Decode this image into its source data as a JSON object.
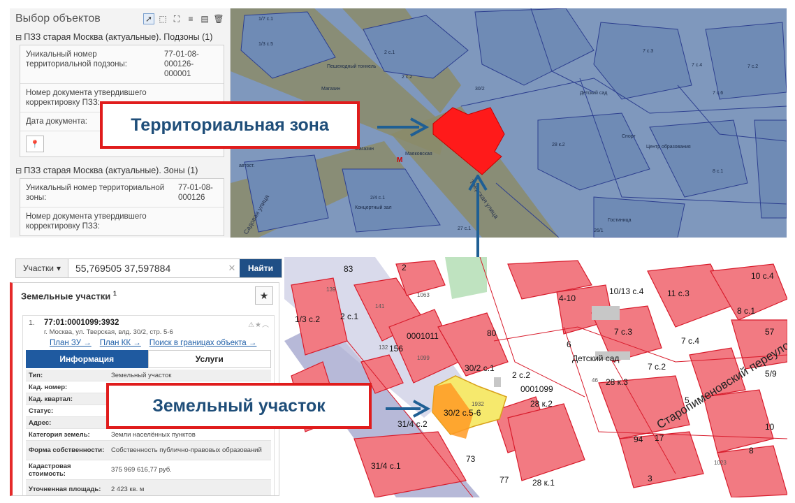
{
  "top_panel": {
    "title": "Выбор объектов",
    "tools": [
      "pointer-icon",
      "frame-select-icon",
      "polygon-select-icon",
      "list-icon",
      "export-icon",
      "trash-icon"
    ],
    "subzones_group": {
      "title": "ПЗЗ старая Москва (актуальные). Подзоны (1)",
      "rows": [
        {
          "key": "Уникальный номер территориальной подзоны:",
          "value": "77-01-08-000126-000001"
        },
        {
          "key": "Номер документа утвердившего корректировку ПЗЗ:",
          "value": ""
        },
        {
          "key": "Дата документа:",
          "value": ""
        }
      ]
    },
    "zones_group": {
      "title": "ПЗЗ старая Москва (актуальные). Зоны (1)",
      "rows": [
        {
          "key": "Уникальный номер территориальной зоны:",
          "value": "77-01-08-000126"
        },
        {
          "key": "Номер документа утвердившего корректировку ПЗЗ:",
          "value": ""
        }
      ]
    }
  },
  "top_map": {
    "labels": [
      "Магазин",
      "Магазин",
      "Маяковская",
      "Концертный зал",
      "Детский сад",
      "Спорт",
      "Центр образования",
      "Гостиница",
      "Пешеходный тоннель",
      "автост.",
      "2 с.1",
      "2 с.2",
      "1/7 с.1",
      "1/3 с.5",
      "30/2",
      "28 к.2",
      "2/4 с.1",
      "7 с.3",
      "7 с.4",
      "7 с.2",
      "7 с.6",
      "26/1",
      "27 с.1",
      "8 с.1"
    ],
    "streets": [
      "Тверская улица",
      "Садовая улица"
    ]
  },
  "callouts": {
    "zone": "Территориальная зона",
    "plot": "Земельный участок"
  },
  "search": {
    "mode": "Участки",
    "value": "55,769505 37,597884",
    "clear": "✕",
    "find": "Найти"
  },
  "plots_panel": {
    "title": "Земельные участки",
    "count": "1",
    "item": {
      "num": "1.",
      "cadastral": "77:01:0001099:3932",
      "address": "г. Москва, ул. Тверская, влд. 30/2, стр. 5-6",
      "links": [
        "План ЗУ →",
        "План КК →",
        "Поиск в границах объекта →"
      ]
    },
    "tabs": [
      "Информация",
      "Услуги"
    ],
    "info": [
      {
        "key": "Тип:",
        "value": "Земельный участок"
      },
      {
        "key": "Кад. номер:",
        "value": ""
      },
      {
        "key": "Кад. квартал:",
        "value": ""
      },
      {
        "key": "Статус:",
        "value": ""
      },
      {
        "key": "Адрес:",
        "value": ""
      },
      {
        "key": "Категория земель:",
        "value": "Земли населённых пунктов"
      },
      {
        "key": "Форма собственности:",
        "value": "Собственность публично-правовых образований"
      },
      {
        "key": "Кадастровая стоимость:",
        "value": "375 969 616,77 руб."
      },
      {
        "key": "Уточненная площадь:",
        "value": "2 423 кв. м"
      }
    ]
  },
  "bottom_map": {
    "labels": [
      "83",
      "2",
      "1/3 с.2",
      "2 с.1",
      "141",
      "1063",
      "139",
      "4-10",
      "10/13 с.4",
      "11 с.3",
      "10 с.4",
      "8 с.1",
      "57",
      "156",
      "0001011",
      "80",
      "1099",
      "30/2 с.1",
      "6",
      "Детский сад",
      "7 с.3",
      "7 с.4",
      "7 с.2",
      "2 с.2",
      "28 к.3",
      "5/9",
      "0001099",
      "28 к.2",
      "5",
      "30/2 с.5-6",
      "31/4 с.2",
      "94",
      "17",
      "8",
      "10",
      "31/4 с.1",
      "28 к.1",
      "3",
      "1023",
      "1932",
      "132",
      "46",
      "73",
      "77"
    ],
    "street": "Старопименовский переулок"
  }
}
